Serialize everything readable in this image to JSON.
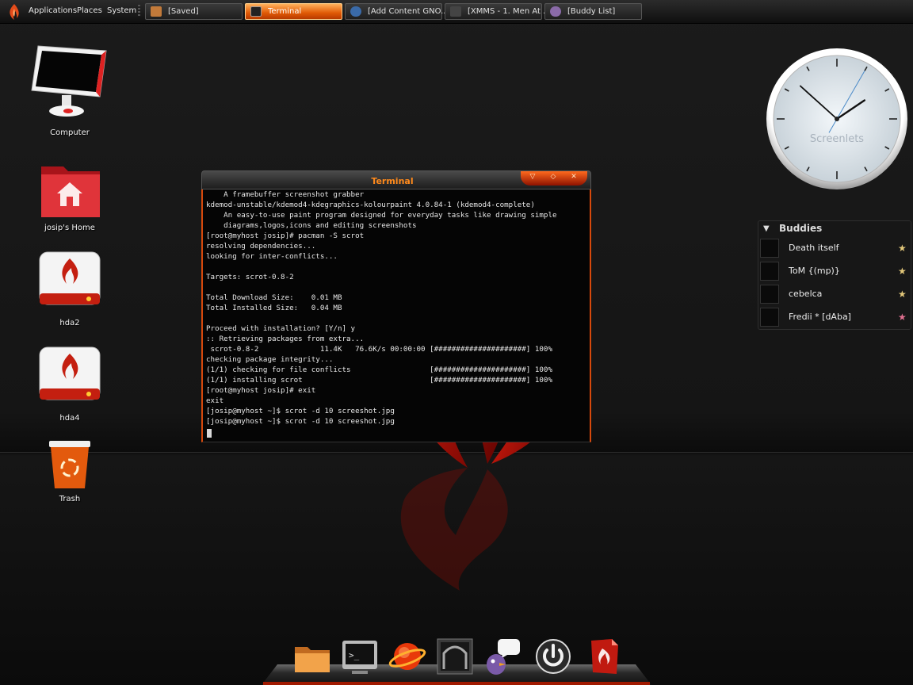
{
  "top_panel": {
    "menus": [
      "Applications",
      "Places",
      "System"
    ],
    "tasks": [
      {
        "label": "[Saved]",
        "icon": "folder-icon",
        "active": false
      },
      {
        "label": "Terminal",
        "icon": "terminal-icon",
        "active": true
      },
      {
        "label": "[Add Content GNO...",
        "icon": "browser-icon",
        "active": false
      },
      {
        "label": "[XMMS - 1. Men At ...",
        "icon": "media-player-icon",
        "active": false
      },
      {
        "label": "[Buddy List]",
        "icon": "pidgin-icon",
        "active": false
      }
    ]
  },
  "desktop_icons": [
    {
      "label": "Computer",
      "icon": "computer-icon"
    },
    {
      "label": "josip's Home",
      "icon": "home-folder-icon"
    },
    {
      "label": "hda2",
      "icon": "drive-icon"
    },
    {
      "label": "hda4",
      "icon": "drive-icon"
    },
    {
      "label": "Trash",
      "icon": "trash-icon"
    }
  ],
  "terminal": {
    "title": "Terminal",
    "lines": [
      "    A framebuffer screenshot grabber",
      "kdemod-unstable/kdemod4-kdegraphics-kolourpaint 4.0.84-1 (kdemod4-complete)",
      "    An easy-to-use paint program designed for everyday tasks like drawing simple",
      "    diagrams,logos,icons and editing screenshots",
      "[root@myhost josip]# pacman -S scrot",
      "resolving dependencies...",
      "looking for inter-conflicts...",
      "",
      "Targets: scrot-0.8-2",
      "",
      "Total Download Size:    0.01 MB",
      "Total Installed Size:   0.04 MB",
      "",
      "Proceed with installation? [Y/n] y",
      ":: Retrieving packages from extra...",
      " scrot-0.8-2              11.4K   76.6K/s 00:00:00 [#####################] 100%",
      "checking package integrity...",
      "(1/1) checking for file conflicts                  [#####################] 100%",
      "(1/1) installing scrot                             [#####################] 100%",
      "[root@myhost josip]# exit",
      "exit",
      "[josip@myhost ~]$ scrot -d 10 screeshot.jpg",
      "[josip@myhost ~]$ scrot -d 10 screeshot.jpg"
    ]
  },
  "clock": {
    "label": "Screenlets",
    "hour": 1,
    "minute": 52,
    "second": 35
  },
  "buddies": {
    "header": "Buddies",
    "items": [
      {
        "name": "Death itself",
        "star_color": "#e2c77a"
      },
      {
        "name": "ToM {(mp)}",
        "star_color": "#e2c77a"
      },
      {
        "name": "cebelca",
        "star_color": "#e2c77a"
      },
      {
        "name": "Fredii * [dAba]",
        "star_color": "#e07090"
      }
    ]
  },
  "dock": {
    "items": [
      "folder-icon",
      "terminal-icon",
      "web-browser-icon",
      "image-viewer-icon",
      "pidgin-chat-icon",
      "power-icon",
      "pdf-document-icon"
    ]
  },
  "colors": {
    "accent": "#e05a05",
    "flame": "#c4200a",
    "panel": "#1e1e1e"
  }
}
